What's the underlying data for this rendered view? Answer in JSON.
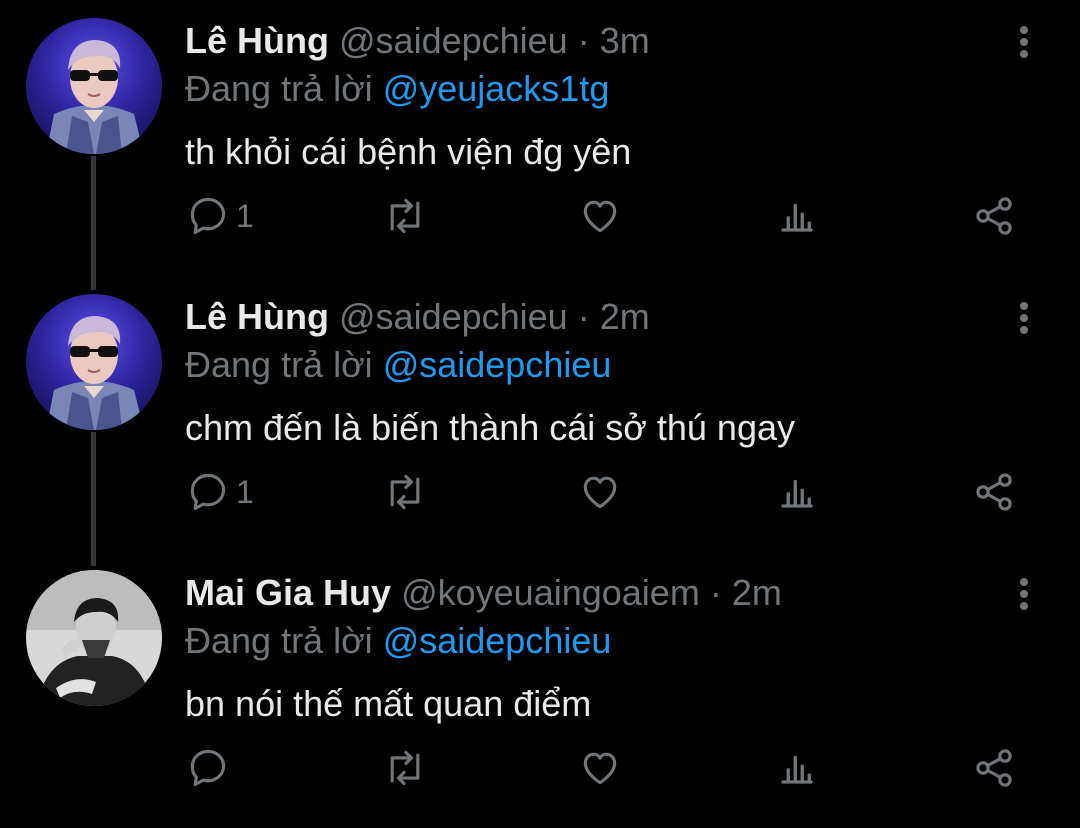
{
  "tweets": [
    {
      "name": "Lê Hùng",
      "handle": "@saidepchieu",
      "separator": "·",
      "time": "3m",
      "replying_prefix": "Đang trả lời",
      "replying_to": "@yeujacks1tg",
      "text": "th khỏi cái bệnh viện đg yên",
      "reply_count": "1",
      "avatar": "avatar-le-hung"
    },
    {
      "name": "Lê Hùng",
      "handle": "@saidepchieu",
      "separator": "·",
      "time": "2m",
      "replying_prefix": "Đang trả lời",
      "replying_to": "@saidepchieu",
      "text": "chm đến là biến thành cái sở thú ngay",
      "reply_count": "1",
      "avatar": "avatar-le-hung"
    },
    {
      "name": "Mai Gia Huy",
      "handle": "@koyeuaingoaiem",
      "separator": "·",
      "time": "2m",
      "replying_prefix": "Đang trả lời",
      "replying_to": "@saidepchieu",
      "text": "bn nói thế mất quan điểm",
      "reply_count": "",
      "avatar": "avatar-mai-gia-huy"
    }
  ],
  "icons": {
    "reply": "reply-icon",
    "retweet": "retweet-icon",
    "like": "heart-icon",
    "analytics": "analytics-icon",
    "share": "share-icon",
    "more": "more-vertical-icon"
  },
  "colors": {
    "background": "#000000",
    "text": "#e7e9ea",
    "secondary": "#71767b",
    "link": "#1d9bf0",
    "thread_line": "#333639"
  }
}
